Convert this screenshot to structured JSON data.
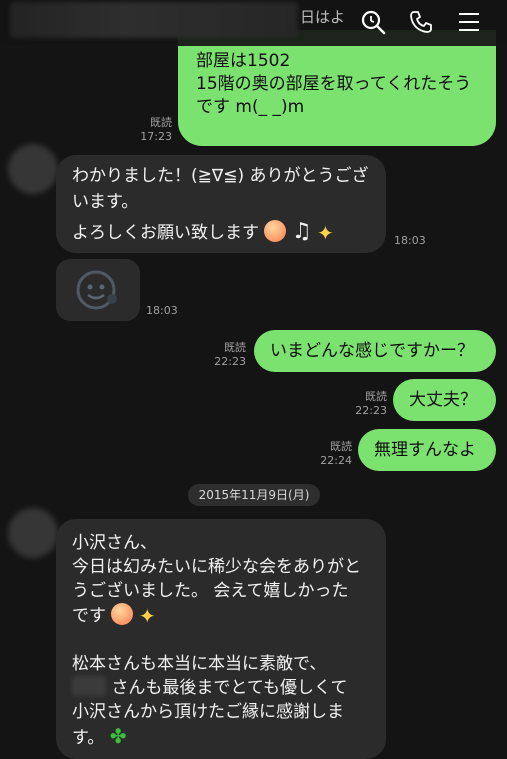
{
  "header": {
    "snippet": "日はよ",
    "icons": [
      "search-icon",
      "phone-icon",
      "menu-icon"
    ]
  },
  "messages": {
    "m1": {
      "line1": "部屋は1502",
      "line2": "15階の奥の部屋を取ってくれたそう",
      "line3": "です m(_ _)m",
      "read": "既読",
      "time": "17:23"
    },
    "m2": {
      "line1": "わかりました！(≧∇≦) ありがとうござ",
      "line2": "います。",
      "line3": "よろしくお願い致します",
      "music": "♫",
      "time": "18:03"
    },
    "m3": {
      "time": "18:03"
    },
    "m4": {
      "text": "いまどんな感じですかー？",
      "read": "既読",
      "time": "22:23"
    },
    "m5": {
      "text": "大丈夫？",
      "read": "既読",
      "time": "22:23"
    },
    "m6": {
      "text": "無理すんなよ",
      "read": "既読",
      "time": "22:24"
    },
    "m7": {
      "line1": "小沢さん、",
      "line2": "今日は幻みたいに稀少な会をありがと",
      "line3": "うございました。 会えて嬉しかった",
      "line4": "です",
      "line5": "松本さんも本当に本当に素敵で、",
      "line6": "さんも最後までとても優しくて",
      "line7": "小沢さんから頂けたご縁に感謝しま",
      "line8": "す。"
    }
  },
  "date_separator": "2015年11月9日(月)",
  "colors": {
    "sent_bubble": "#7ce26f",
    "received_bubble": "#2b2b2b",
    "background": "#141414"
  }
}
